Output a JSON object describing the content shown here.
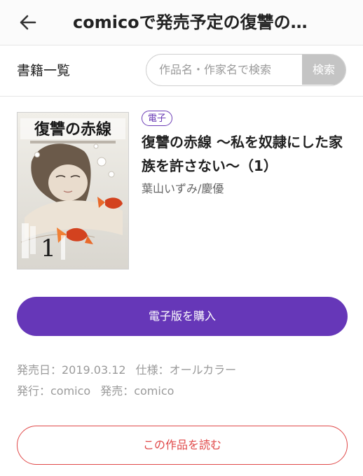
{
  "header": {
    "title": "comicoで発売予定の復讐の…"
  },
  "list_bar": {
    "title": "書籍一覧",
    "search_placeholder": "作品名・作家名で検索",
    "search_button": "検索"
  },
  "book": {
    "cover_title_text": "復讐の赤線",
    "cover_volume": "1",
    "badge": "電子",
    "title": "復讐の赤線 〜私を奴隷にした家族を許さない〜（1）",
    "author": "葉山いずみ/慶優",
    "buy_label": "電子版を購入",
    "release_label": "発売日：2019.03.12",
    "spec_label": "仕様：オールカラー",
    "publisher_label": "発行：comico",
    "seller_label": "発売：comico",
    "read_label": "この作品を読む"
  },
  "colors": {
    "accent": "#6637b8",
    "danger": "#e04848",
    "muted": "#9a9a9a"
  },
  "icons": {
    "back": "arrow-left-icon"
  }
}
